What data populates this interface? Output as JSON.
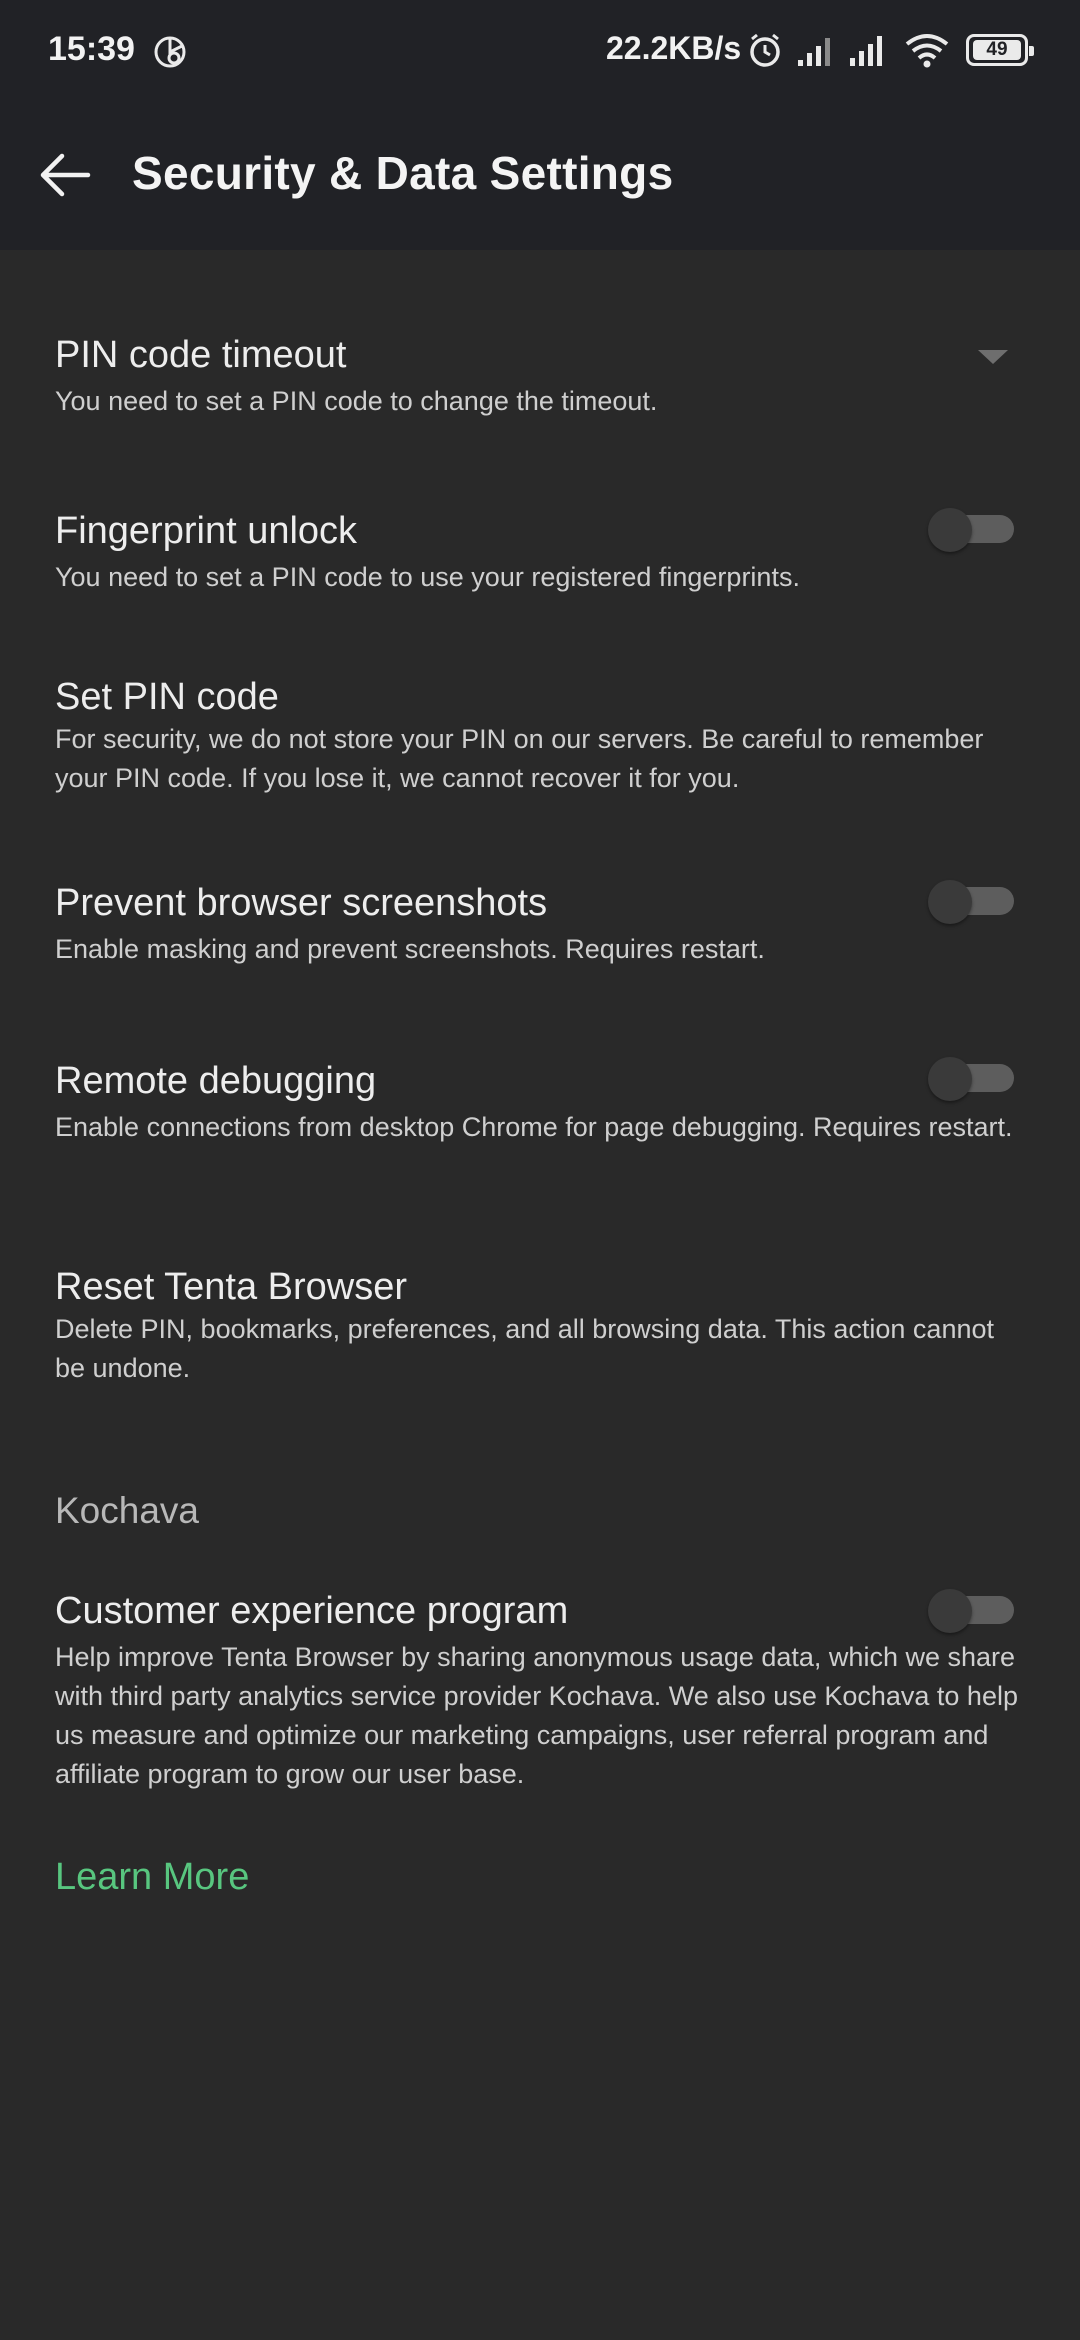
{
  "status_bar": {
    "time": "15:39",
    "network_speed": "22.2KB/s",
    "battery_level": "49",
    "icons": [
      "app-status-icon",
      "alarm-icon",
      "signal-icon",
      "signal-icon",
      "wifi-icon",
      "battery-icon"
    ]
  },
  "app_bar": {
    "title": "Security & Data Settings",
    "back_icon": "arrow-left-icon"
  },
  "settings": {
    "pin_timeout": {
      "title": "PIN code timeout",
      "description": "You need to set a PIN code to change the timeout."
    },
    "fingerprint": {
      "title": "Fingerprint unlock",
      "description": "You need to set a PIN code to use your registered fingerprints.",
      "enabled": false
    },
    "set_pin": {
      "title": "Set PIN code",
      "description": "For security, we do not store your PIN on our servers. Be careful to remember your PIN code. If you lose it, we cannot recover it for you."
    },
    "prevent_screenshots": {
      "title": "Prevent browser screenshots",
      "description": "Enable masking and prevent screenshots. Requires restart.",
      "enabled": false
    },
    "remote_debugging": {
      "title": "Remote debugging",
      "description": "Enable connections from desktop Chrome for page debugging. Requires restart.",
      "enabled": false
    },
    "reset": {
      "title": "Reset Tenta Browser",
      "description": "Delete PIN, bookmarks, preferences, and all browsing data. This action cannot be undone."
    }
  },
  "kochava_section": {
    "header": "Kochava",
    "customer_experience": {
      "title": "Customer experience program",
      "description": "Help improve Tenta Browser by sharing anonymous usage data, which we share with third party analytics service provider Kochava. We also use Kochava to help us measure and optimize our marketing campaigns, user referral program and affiliate program to grow our user base.",
      "enabled": false
    },
    "learn_more": "Learn More"
  },
  "colors": {
    "background": "#292929",
    "app_bar": "#212226",
    "accent_link": "#58c67f",
    "toggle_track_off": "#5d5d5d",
    "toggle_thumb_off": "#3a3a3a"
  }
}
